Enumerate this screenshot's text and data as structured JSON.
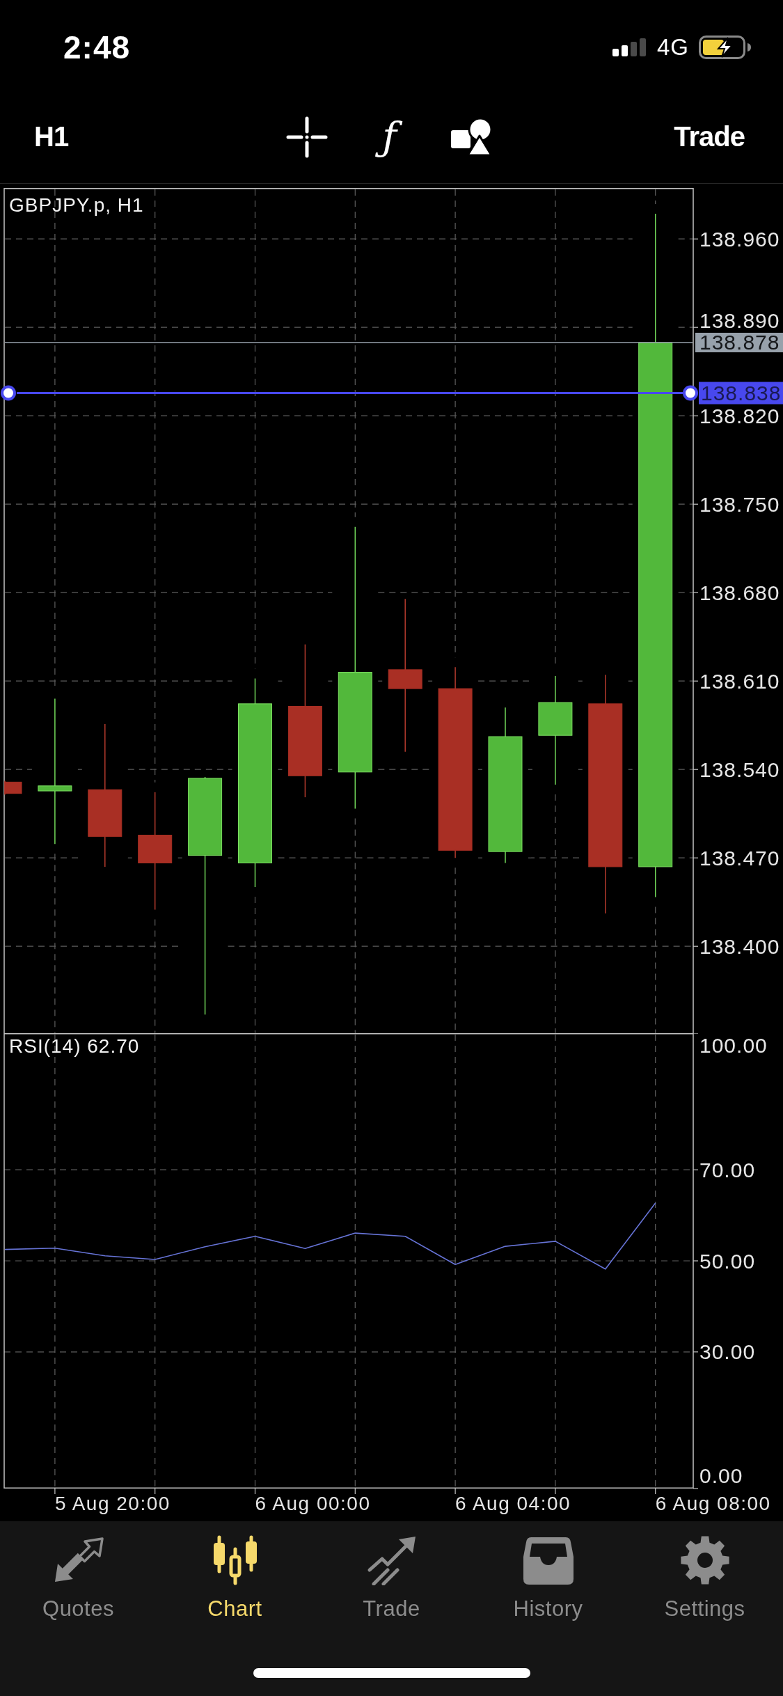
{
  "status_bar": {
    "time": "2:48",
    "network": "4G"
  },
  "toolbar": {
    "timeframe": "H1",
    "indicators_glyph": "ƒ",
    "trade_label": "Trade"
  },
  "price_chart": {
    "title": "GBPJPY.p, H1",
    "price_axis": [
      "138.960",
      "138.890",
      "138.820",
      "138.750",
      "138.680",
      "138.610",
      "138.540",
      "138.470",
      "138.400"
    ],
    "price_lines": [
      {
        "kind": "bid",
        "label": "138.878",
        "color": "#97a1ab"
      },
      {
        "kind": "level",
        "label": "138.838",
        "color": "#4848ee"
      }
    ]
  },
  "rsi_chart": {
    "title": "RSI(14) 62.70",
    "scale": [
      "100.00",
      "70.00",
      "50.00",
      "30.00",
      "0.00"
    ]
  },
  "time_axis": [
    "5 Aug 20:00",
    "6 Aug 00:00",
    "6 Aug 04:00",
    "6 Aug 08:00"
  ],
  "tabs": [
    {
      "label": "Quotes",
      "selected": false
    },
    {
      "label": "Chart",
      "selected": true
    },
    {
      "label": "Trade",
      "selected": false
    },
    {
      "label": "History",
      "selected": false
    },
    {
      "label": "Settings",
      "selected": false
    }
  ]
}
